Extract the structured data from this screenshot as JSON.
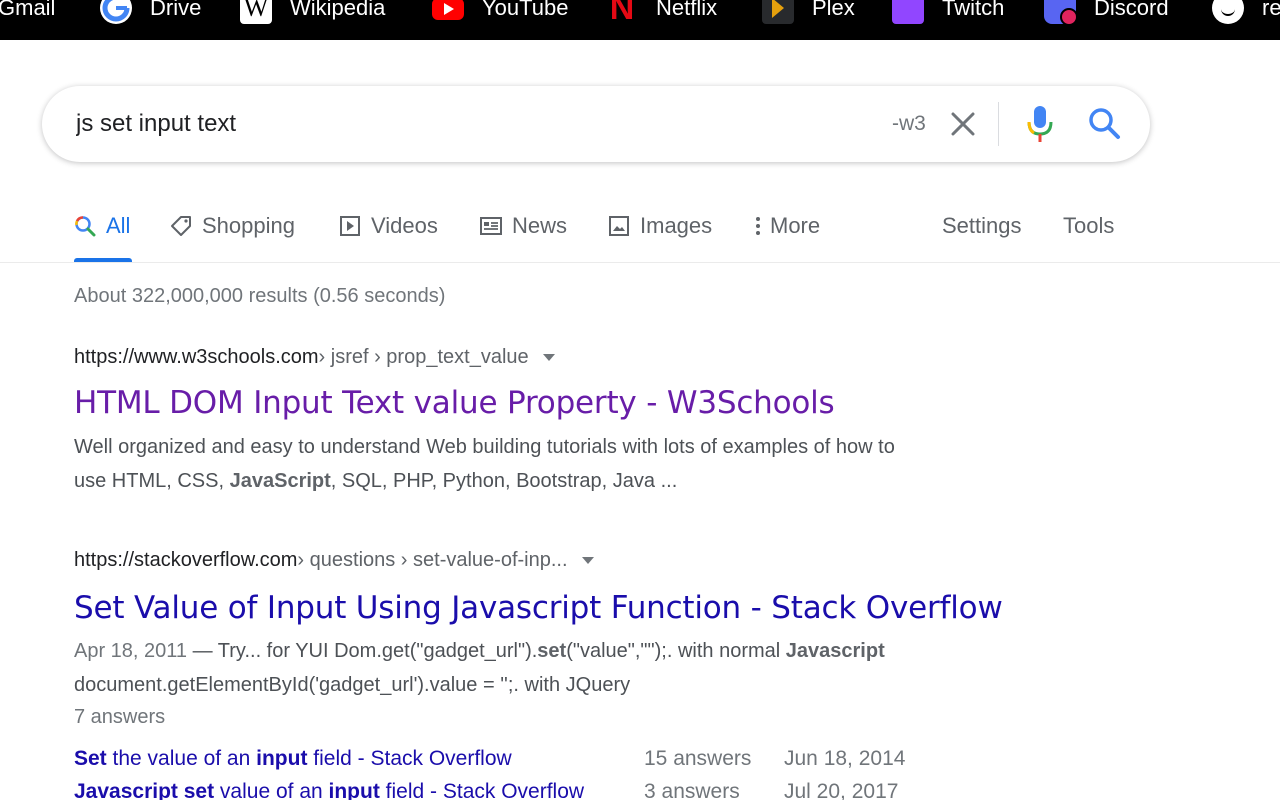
{
  "bookmarks": [
    {
      "label": "Gmail",
      "icon": "gmail-icon"
    },
    {
      "label": "Drive",
      "icon": "google-icon"
    },
    {
      "label": "Wikipedia",
      "icon": "wikipedia-icon"
    },
    {
      "label": "YouTube",
      "icon": "youtube-icon"
    },
    {
      "label": "Netflix",
      "icon": "netflix-icon"
    },
    {
      "label": "Plex",
      "icon": "plex-icon"
    },
    {
      "label": "Twitch",
      "icon": "twitch-icon"
    },
    {
      "label": "Discord",
      "icon": "discord-icon"
    },
    {
      "label": "re",
      "icon": "reddit-icon"
    }
  ],
  "search": {
    "query": "js set input text",
    "suffix": "-w3"
  },
  "tabs": [
    {
      "label": "All",
      "icon": "search-icon",
      "active": true
    },
    {
      "label": "Shopping",
      "icon": "tag-icon"
    },
    {
      "label": "Videos",
      "icon": "play-icon"
    },
    {
      "label": "News",
      "icon": "news-icon"
    },
    {
      "label": "Images",
      "icon": "image-icon"
    },
    {
      "label": "More",
      "icon": "more-vert-icon"
    },
    {
      "label": "Settings"
    },
    {
      "label": "Tools"
    }
  ],
  "stats": "About 322,000,000 results (0.56 seconds)",
  "results": [
    {
      "domain": "https://www.w3schools.com",
      "path": " › jsref › prop_text_value",
      "title": "HTML DOM Input Text value Property - W3Schools",
      "snippet": {
        "line1": "Well organized and easy to understand Web building tutorials with lots of examples of how to",
        "line2_a": "use HTML, CSS, ",
        "line2_bold": "JavaScript",
        "line2_b": ", SQL, PHP, Python, Bootstrap, Java ..."
      }
    },
    {
      "domain": "https://stackoverflow.com",
      "path": " › questions › set-value-of-inp...",
      "title": "Set Value of Input Using Javascript Function - Stack Overflow",
      "snippet": {
        "date": "Apr 18, 2011",
        "line1_a": " — Try... for YUI Dom.get(\"gadget_url\").",
        "line1_bold1": "set",
        "line1_b": "(\"value\",\"\");. with normal ",
        "line1_bold2": "Javascript",
        "line2": "document.getElementById('gadget_url').value = '';. with JQuery"
      },
      "answers": "7 answers",
      "sublinks": [
        {
          "bold1": "Set",
          "t1": " the value of an ",
          "bold2": "input",
          "t2": " field - Stack Overflow",
          "answers": "15 answers",
          "date": "Jun 18, 2014"
        },
        {
          "bold1": "Javascript set",
          "t1": " value of an ",
          "bold2": "input",
          "t2": " field - Stack Overflow",
          "answers": "3 answers",
          "date": "Jul 20, 2017"
        }
      ]
    }
  ],
  "colors": {
    "link_visited": "#681da8",
    "link": "#1a0dab",
    "accent": "#1a73e8"
  }
}
